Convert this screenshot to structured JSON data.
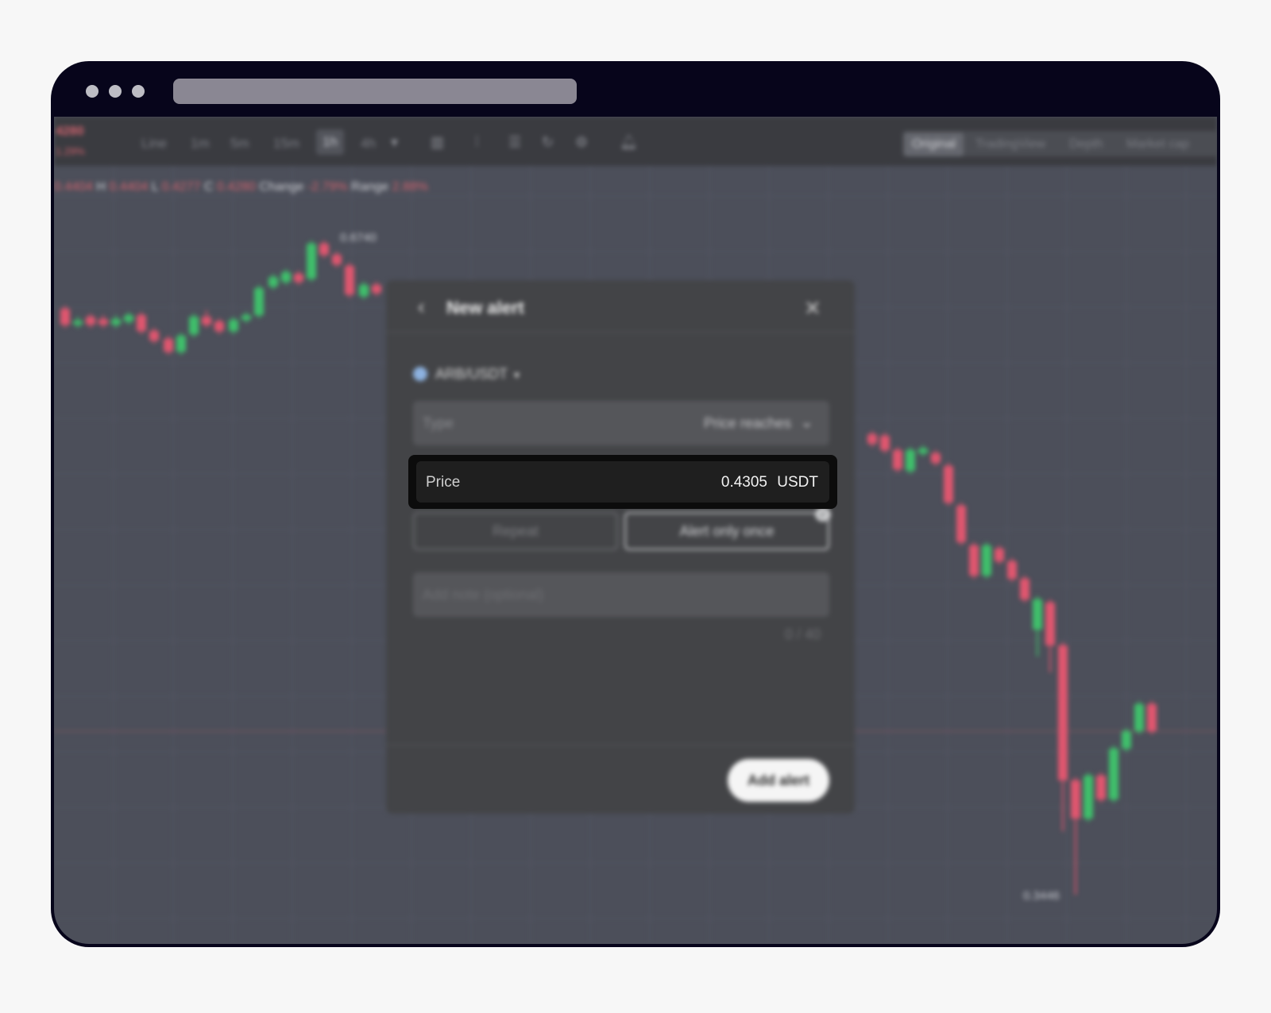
{
  "chart_toolbar": {
    "ticker_price": "4280",
    "ticker_change": "1.29%",
    "intervals": [
      "Line",
      "1m",
      "5m",
      "15m",
      "1h",
      "4h"
    ],
    "active_interval": "1h",
    "view_tabs": [
      "Original",
      "TradingView",
      "Depth",
      "Market cap"
    ],
    "active_view": "Original"
  },
  "ohlc": {
    "open_value": "0.4404",
    "high_label": "H",
    "high_value": "0.4404",
    "low_label": "L",
    "low_value": "0.4277",
    "close_label": "C",
    "close_value": "0.4280",
    "change_label": "Change",
    "change_value": "-2.79%",
    "range_label": "Range",
    "range_value": "2.88%"
  },
  "chart_labels": {
    "high_marker": "0.6740",
    "low_marker": "0.3446"
  },
  "modal": {
    "title": "New alert",
    "pair": "ARB/USDT",
    "type_label": "Type",
    "type_value": "Price reaches",
    "price_label": "Price",
    "price_value": "0.4305",
    "price_unit": "USDT",
    "repeat_label": "Repeat",
    "once_label": "Alert only once",
    "note_placeholder": "Add note (optional)",
    "char_count": "0 / 40",
    "add_button": "Add alert"
  },
  "colors": {
    "up": "#3fbf6b",
    "down": "#e0566f",
    "background": "#4c4f5a",
    "browser_frame": "#07051b"
  }
}
